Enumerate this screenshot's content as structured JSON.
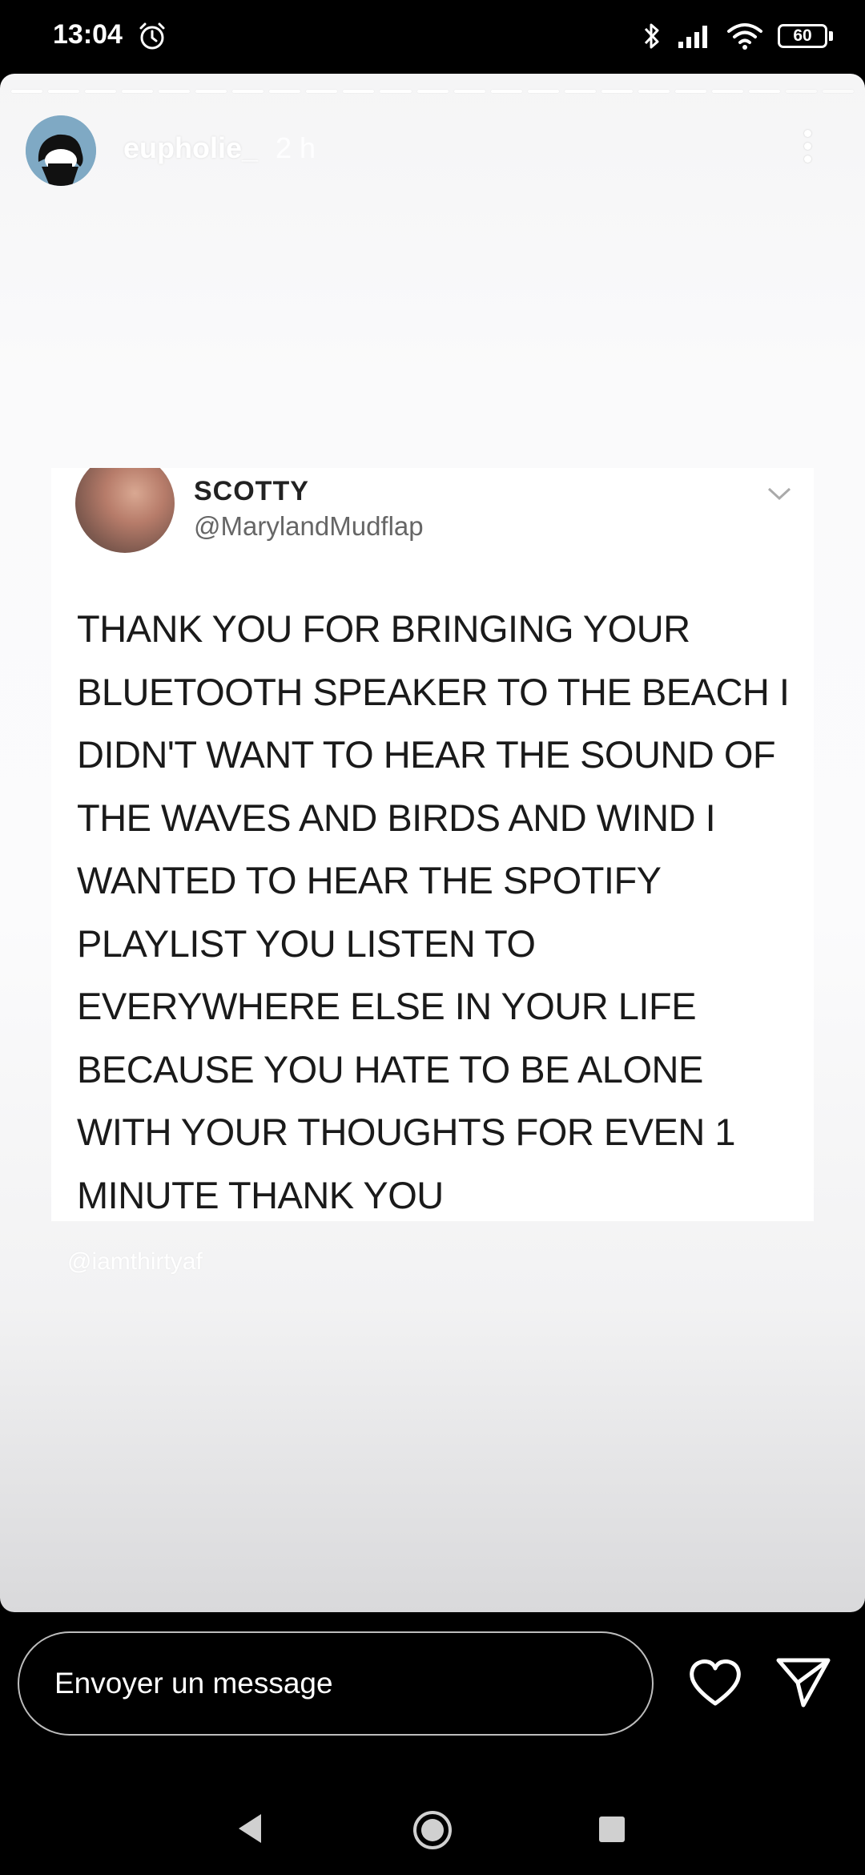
{
  "status_bar": {
    "time": "13:04",
    "battery": "60"
  },
  "story": {
    "username": "eupholie_",
    "time_ago": "2 h",
    "tweet": {
      "name": "SCOTTY",
      "handle": "@MarylandMudflap",
      "text": "THANK YOU FOR BRINGING YOUR BLUETOOTH SPEAKER TO THE BEACH I DIDN'T WANT TO HEAR THE SOUND OF THE WAVES AND BIRDS AND WIND I WANTED TO HEAR THE SPOTIFY PLAYLIST YOU LISTEN TO EVERYWHERE ELSE IN YOUR LIFE BECAUSE YOU HATE TO BE ALONE WITH YOUR THOUGHTS FOR EVEN 1 MINUTE THANK YOU"
    },
    "watermark": "@iamthirtyaf"
  },
  "reply_bar": {
    "placeholder": "Envoyer un message"
  },
  "icons": {
    "alarm": "alarm-icon",
    "bluetooth": "bluetooth-icon",
    "signal": "signal-icon",
    "wifi": "wifi-icon",
    "battery": "battery-icon",
    "more": "more-vertical-icon",
    "chevron": "chevron-down-icon",
    "heart": "heart-icon",
    "send": "send-icon",
    "back": "back-triangle-icon",
    "home": "home-circle-icon",
    "recents": "recents-square-icon"
  }
}
